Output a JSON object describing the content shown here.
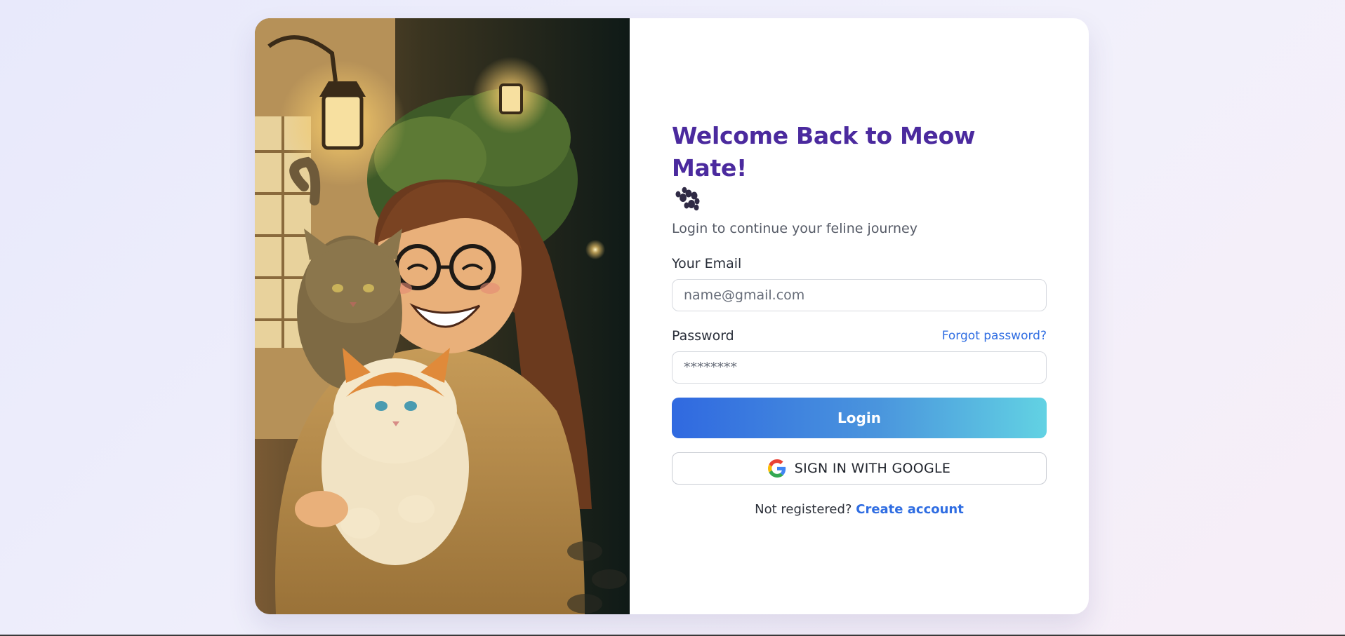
{
  "login": {
    "title": "Welcome Back to Meow Mate!",
    "paw_icon": "paw-prints-icon",
    "subtitle": "Login to continue your feline journey",
    "email_label": "Your Email",
    "email_placeholder": "name@gmail.com",
    "email_value": "",
    "password_label": "Password",
    "forgot_link": "Forgot password?",
    "password_placeholder": "********",
    "password_value": "",
    "login_button": "Login",
    "google_button": "SIGN IN WITH GOOGLE",
    "google_icon": "google-g-icon",
    "not_registered": "Not registered?",
    "create_account": "Create account"
  },
  "colors": {
    "title": "#4b2a9e",
    "link": "#2f6de2",
    "button_gradient_start": "#3069e0",
    "button_gradient_end": "#62d2e3"
  }
}
